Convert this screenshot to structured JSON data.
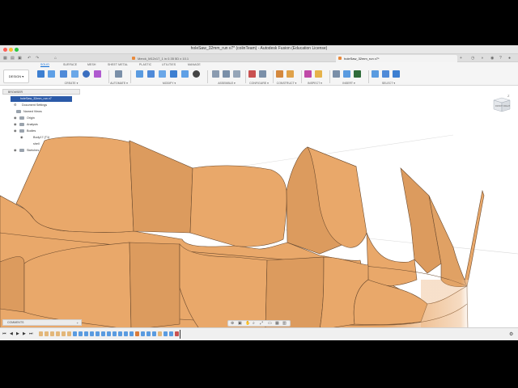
{
  "window": {
    "title": "holeSaw_32mm_run v7* (colinTeam) - Autodesk Fusion (Education License)"
  },
  "tabs": [
    {
      "label": "Merck_M12v17_1 in 0.35 5D x 10.1"
    },
    {
      "label": "holeSaw_32mm_run v7*"
    }
  ],
  "workspace_tabs": [
    "SOLID",
    "SURFACE",
    "MESH",
    "SHEET METAL",
    "PLASTIC",
    "UTILITIES",
    "MANAGE"
  ],
  "active_workspace_tab": "SOLID",
  "toolbar": {
    "design_label": "DESIGN ▾",
    "groups": [
      "CREATE ▾",
      "AUTOMATE ▾",
      "MODIFY ▾",
      "ASSEMBLE ▾",
      "CONFIGURE ▾",
      "CONSTRUCT ▾",
      "INSPECT ▾",
      "INSERT ▾",
      "SELECT ▾"
    ]
  },
  "browser": {
    "header": "BROWSER",
    "root": "holeSaw_32mm_run v7",
    "items": [
      {
        "label": "Document Settings"
      },
      {
        "label": "Named Views"
      },
      {
        "label": "Origin"
      },
      {
        "label": "Analysis"
      },
      {
        "label": "Bodies"
      },
      {
        "label": "Body17 (T1)"
      },
      {
        "label": "shell"
      },
      {
        "label": "Sketches"
      }
    ]
  },
  "viewcube": {
    "top_label": "TOP",
    "front_label": "FRONT",
    "right_label": "RIGHT",
    "axis_z": "Z"
  },
  "comments": {
    "label": "COMMENTS",
    "add": "+"
  },
  "colors": {
    "body": "#e9a86a",
    "body_shade": "#d99455",
    "edge": "#6b4a2e",
    "accent": "#0a6ad6"
  },
  "icons": {
    "settings": "gear-icon"
  }
}
